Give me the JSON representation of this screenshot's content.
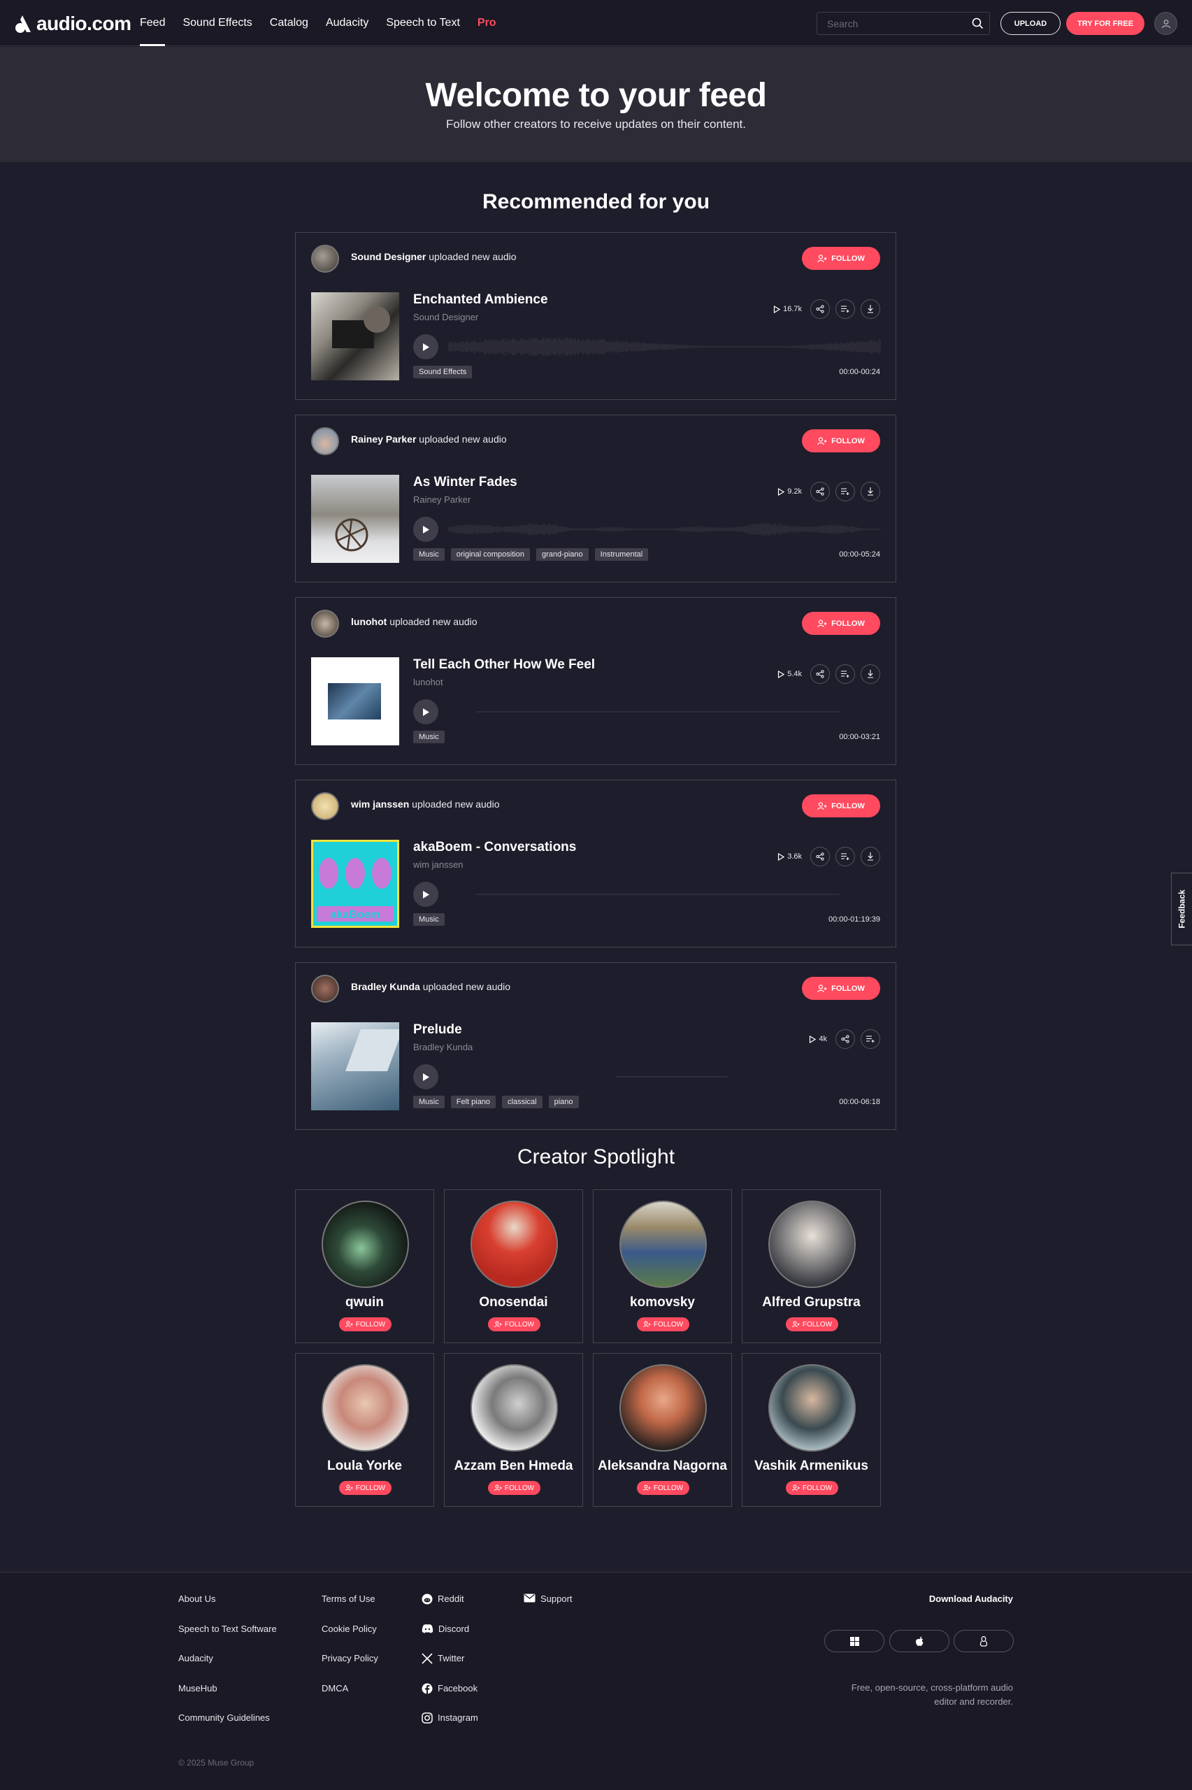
{
  "header": {
    "logo_text": "audio.com",
    "nav": [
      {
        "label": "Feed",
        "active": true
      },
      {
        "label": "Sound Effects"
      },
      {
        "label": "Catalog"
      },
      {
        "label": "Audacity"
      },
      {
        "label": "Speech to Text"
      },
      {
        "label": "Pro"
      }
    ],
    "search_placeholder": "Search",
    "upload_label": "UPLOAD",
    "try_label": "TRY FOR FREE"
  },
  "hero": {
    "title": "Welcome to your feed",
    "subtitle": "Follow other creators to receive updates on their content."
  },
  "recommended": {
    "title": "Recommended for you",
    "follow_label": "FOLLOW",
    "uploaded_text": "uploaded new audio",
    "cards": [
      {
        "user": "Sound Designer",
        "title": "Enchanted Ambience",
        "artist": "Sound Designer",
        "plays": "16.7k",
        "tags": [
          "Sound Effects"
        ],
        "duration": "00:00-00:24",
        "download": true
      },
      {
        "user": "Rainey Parker",
        "title": "As Winter Fades",
        "artist": "Rainey Parker",
        "plays": "9.2k",
        "tags": [
          "Music",
          "original composition",
          "grand-piano",
          "Instrumental"
        ],
        "duration": "00:00-05:24",
        "download": true
      },
      {
        "user": "lunohot",
        "title": "Tell Each Other How We Feel",
        "artist": "lunohot",
        "plays": "5.4k",
        "tags": [
          "Music"
        ],
        "duration": "00:00-03:21",
        "download": true
      },
      {
        "user": "wim janssen",
        "title": "akaBoem - Conversations",
        "artist": "wim janssen",
        "plays": "3.6k",
        "tags": [
          "Music"
        ],
        "duration": "00:00-01:19:39",
        "download": true
      },
      {
        "user": "Bradley Kunda",
        "title": "Prelude",
        "artist": "Bradley Kunda",
        "plays": "4k",
        "tags": [
          "Music",
          "Felt piano",
          "classical",
          "piano"
        ],
        "duration": "00:00-06:18",
        "download": false
      }
    ]
  },
  "spotlight": {
    "title": "Creator Spotlight",
    "follow_label": "FOLLOW",
    "creators": [
      "qwuin",
      "Onosendai",
      "komovsky",
      "Alfred Grupstra",
      "Loula Yorke",
      "Azzam Ben Hmeda",
      "Aleksandra Nagorna",
      "Vashik Armenikus"
    ]
  },
  "feedback_label": "Feedback",
  "footer": {
    "col1": [
      "About Us",
      "Speech to Text Software",
      "Audacity",
      "MuseHub",
      "Community Guidelines"
    ],
    "col2": [
      "Terms of Use",
      "Cookie Policy",
      "Privacy Policy",
      "DMCA"
    ],
    "social": [
      {
        "label": "Reddit",
        "icon": "reddit-icon"
      },
      {
        "label": "Discord",
        "icon": "discord-icon"
      },
      {
        "label": "Twitter",
        "icon": "x-twitter-icon"
      },
      {
        "label": "Facebook",
        "icon": "facebook-icon"
      },
      {
        "label": "Instagram",
        "icon": "instagram-icon"
      }
    ],
    "support": "Support",
    "download_title": "Download Audacity",
    "download_desc": "Free, open-source, cross-platform audio editor and recorder.",
    "copyright": "© 2025 Muse Group"
  },
  "colors": {
    "accent": "#ff4a5f",
    "background": "#1e1d2b",
    "hero": "#2c2b36"
  }
}
